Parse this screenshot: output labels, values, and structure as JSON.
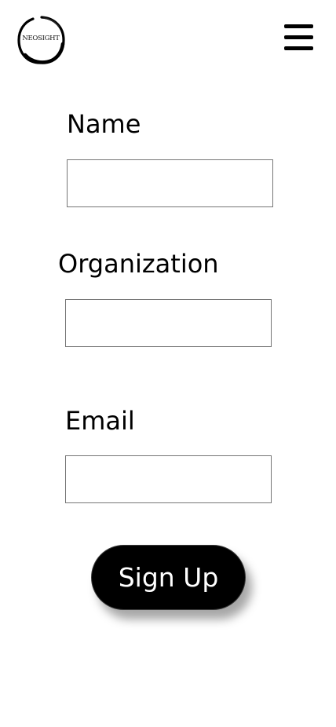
{
  "header": {
    "logo_text": "NEOSIGHT",
    "logo_icon": "ink-circle-logo",
    "menu_icon": "hamburger-menu-icon"
  },
  "form": {
    "fields": [
      {
        "label": "Name",
        "value": "",
        "placeholder": ""
      },
      {
        "label": "Organization",
        "value": "",
        "placeholder": ""
      },
      {
        "label": "Email",
        "value": "",
        "placeholder": ""
      }
    ],
    "submit_label": "Sign Up"
  },
  "colors": {
    "background": "#ffffff",
    "text": "#000000",
    "button_bg": "#000000",
    "button_text": "#ffffff",
    "input_border": "#767676"
  }
}
